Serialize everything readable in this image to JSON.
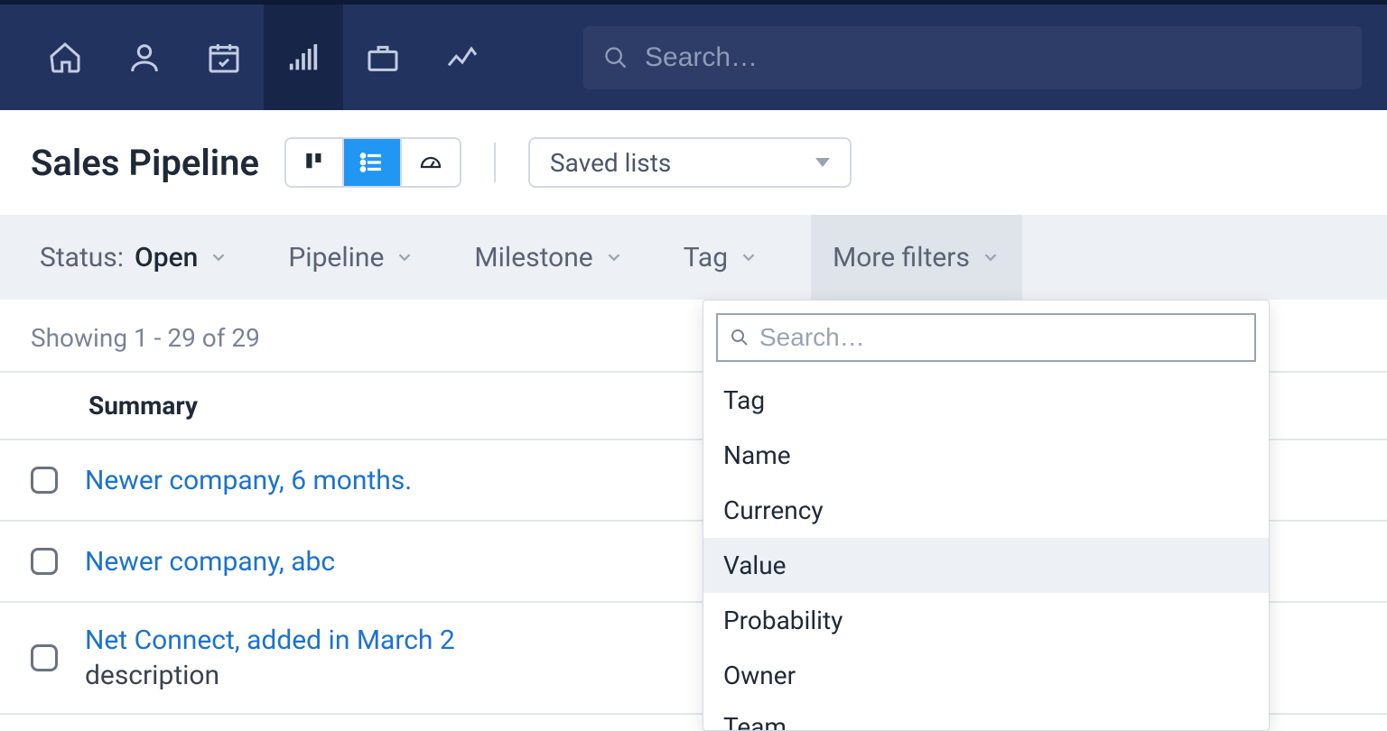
{
  "topnav": {
    "search_placeholder": "Search…"
  },
  "header": {
    "title": "Sales Pipeline",
    "saved_lists_label": "Saved lists"
  },
  "filters": {
    "status_label": "Status: ",
    "status_value": "Open",
    "pipeline": "Pipeline",
    "milestone": "Milestone",
    "tag": "Tag",
    "more": "More filters"
  },
  "count_text": "Showing 1 - 29 of 29",
  "table": {
    "header_summary": "Summary"
  },
  "rows": [
    {
      "title": "Newer company, 6 months.",
      "description": ""
    },
    {
      "title": "Newer company, abc",
      "description": ""
    },
    {
      "title": "Net Connect, added in March 2",
      "description": "description"
    }
  ],
  "more_filters_dropdown": {
    "search_placeholder": "Search…",
    "items": [
      "Tag",
      "Name",
      "Currency",
      "Value",
      "Probability",
      "Owner",
      "Team"
    ],
    "hover_index": 3
  }
}
